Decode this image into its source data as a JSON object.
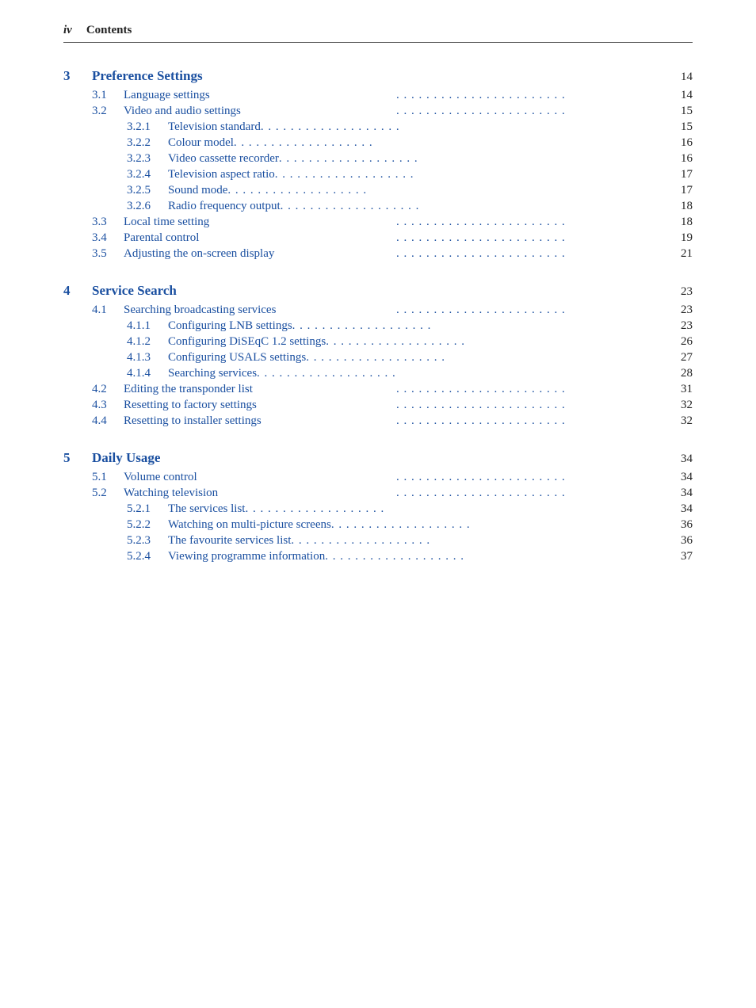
{
  "header": {
    "roman": "iv",
    "title": "Contents"
  },
  "sections": [
    {
      "num": "3",
      "title": "Preference Settings",
      "page": "14",
      "subsections": [
        {
          "num": "3.1",
          "title": "Language settings",
          "page": "14",
          "children": []
        },
        {
          "num": "3.2",
          "title": "Video and audio settings",
          "page": "15",
          "children": [
            {
              "num": "3.2.1",
              "title": "Television standard",
              "page": "15"
            },
            {
              "num": "3.2.2",
              "title": "Colour model",
              "page": "16"
            },
            {
              "num": "3.2.3",
              "title": "Video cassette recorder",
              "page": "16"
            },
            {
              "num": "3.2.4",
              "title": "Television aspect ratio",
              "page": "17"
            },
            {
              "num": "3.2.5",
              "title": "Sound mode",
              "page": "17"
            },
            {
              "num": "3.2.6",
              "title": "Radio frequency output",
              "page": "18"
            }
          ]
        },
        {
          "num": "3.3",
          "title": "Local time setting",
          "page": "18",
          "children": []
        },
        {
          "num": "3.4",
          "title": "Parental control",
          "page": "19",
          "children": []
        },
        {
          "num": "3.5",
          "title": "Adjusting the on-screen display",
          "page": "21",
          "children": []
        }
      ]
    },
    {
      "num": "4",
      "title": "Service Search",
      "page": "23",
      "subsections": [
        {
          "num": "4.1",
          "title": "Searching broadcasting services",
          "page": "23",
          "children": [
            {
              "num": "4.1.1",
              "title": "Configuring LNB settings",
              "page": "23"
            },
            {
              "num": "4.1.2",
              "title": "Configuring DiSEqC 1.2 settings",
              "page": "26"
            },
            {
              "num": "4.1.3",
              "title": "Configuring USALS settings",
              "page": "27"
            },
            {
              "num": "4.1.4",
              "title": "Searching services",
              "page": "28"
            }
          ]
        },
        {
          "num": "4.2",
          "title": "Editing the transponder list",
          "page": "31",
          "children": []
        },
        {
          "num": "4.3",
          "title": "Resetting to factory settings",
          "page": "32",
          "children": []
        },
        {
          "num": "4.4",
          "title": "Resetting to installer settings",
          "page": "32",
          "children": []
        }
      ]
    },
    {
      "num": "5",
      "title": "Daily Usage",
      "page": "34",
      "subsections": [
        {
          "num": "5.1",
          "title": "Volume control",
          "page": "34",
          "children": []
        },
        {
          "num": "5.2",
          "title": "Watching television",
          "page": "34",
          "children": [
            {
              "num": "5.2.1",
              "title": "The services list",
              "page": "34"
            },
            {
              "num": "5.2.2",
              "title": "Watching on multi-picture screens",
              "page": "36"
            },
            {
              "num": "5.2.3",
              "title": "The favourite services list",
              "page": "36"
            },
            {
              "num": "5.2.4",
              "title": "Viewing programme information",
              "page": "37"
            }
          ]
        }
      ]
    }
  ]
}
